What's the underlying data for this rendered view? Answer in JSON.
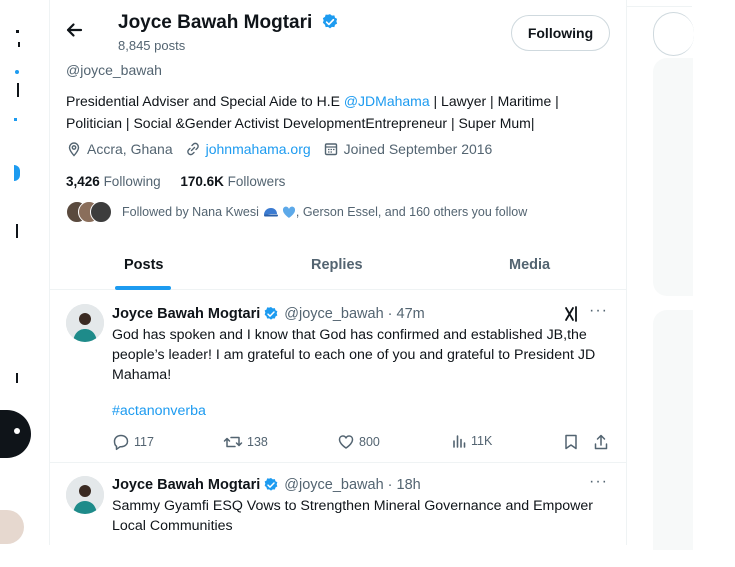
{
  "profile": {
    "name": "Joyce Bawah Mogtari",
    "posts_count": "8,845 posts",
    "follow_button": "Following",
    "handle": "@joyce_bawah",
    "bio_prefix": "Presidential Adviser and Special Aide to H.E ",
    "bio_mention": "@JDMahama",
    "bio_suffix": " | Lawyer | Maritime | Politician | Social &Gender Activist DevelopmentEntrepreneur | Super Mum|",
    "location": "Accra, Ghana",
    "website": "johnmahama.org",
    "joined": "Joined September 2016",
    "following_count": "3,426",
    "following_label": "Following",
    "followers_count": "170.6K",
    "followers_label": "Followers",
    "followed_by_prefix": "Followed by Nana Kwesi",
    "followed_by_suffix": ", Gerson Essel, and 160 others you follow"
  },
  "tabs": [
    {
      "label": "Posts",
      "active": true
    },
    {
      "label": "Replies",
      "active": false
    },
    {
      "label": "Media",
      "active": false
    }
  ],
  "posts": [
    {
      "author": "Joyce Bawah Mogtari",
      "handle_time": "@joyce_bawah · 47m",
      "text": "God has spoken and I know that God has confirmed and established JB,the people’s leader! I am grateful to each one of you and grateful to President JD Mahama!",
      "hashtag": "#actanonverba",
      "replies": "117",
      "reposts": "138",
      "likes": "800",
      "views": "11K"
    },
    {
      "author": "Joyce Bawah Mogtari",
      "handle_time": "@joyce_bawah · 18h",
      "text": "Sammy Gyamfi ESQ Vows to Strengthen Mineral Governance and Empower Local Communities"
    }
  ],
  "colors": {
    "accent": "#1d9bf0",
    "muted": "#536471",
    "text": "#0f1419"
  }
}
